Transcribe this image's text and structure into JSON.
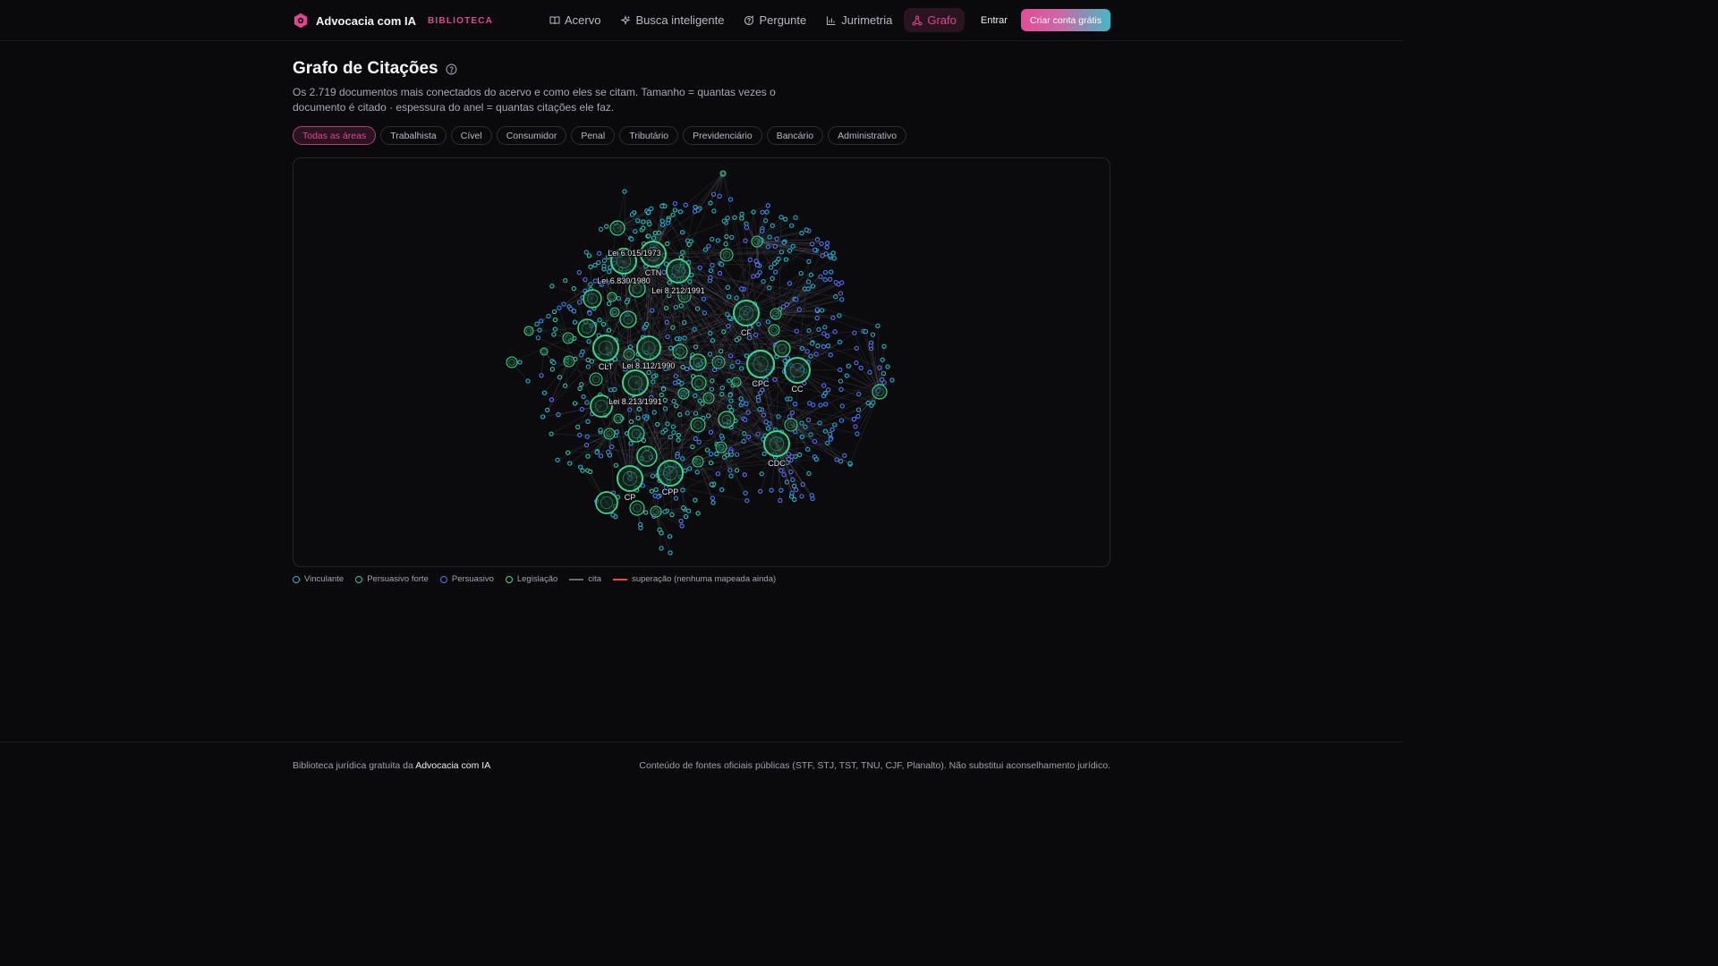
{
  "brand": {
    "name": "Advocacia com IA",
    "tag": "BIBLIOTECA"
  },
  "nav": [
    {
      "label": "Acervo",
      "icon": "book-open-icon"
    },
    {
      "label": "Busca inteligente",
      "icon": "sparkles-icon"
    },
    {
      "label": "Pergunte",
      "icon": "message-circle-question-icon"
    },
    {
      "label": "Jurimetria",
      "icon": "bar-chart-icon"
    },
    {
      "label": "Grafo",
      "icon": "graph-network-icon",
      "active": true
    }
  ],
  "auth": {
    "login_label": "Entrar",
    "signup_label": "Criar conta grátis"
  },
  "page": {
    "title": "Grafo de Citações",
    "description": "Os 2.719 documentos mais conectados do acervo e como eles se citam. Tamanho = quantas vezes o documento é citado · espessura do anel = quantas citações ele faz."
  },
  "filters": {
    "selected": "Todas as áreas",
    "options": [
      "Todas as áreas",
      "Trabalhista",
      "Cível",
      "Consumidor",
      "Penal",
      "Tributário",
      "Previdenciário",
      "Bancário",
      "Administrativo"
    ]
  },
  "graph": {
    "labeled_nodes": [
      "CTN",
      "Lei 6.830/1980",
      "Lei 8.212/1991",
      "Lei 6.015/1973",
      "CF",
      "CLT",
      "Lei 8.112/1990",
      "Lei 8.213/1991",
      "CPC",
      "CC",
      "CDC",
      "CP",
      "CPP"
    ]
  },
  "legend": [
    {
      "label": "Vinculante",
      "kind": "dot",
      "color": "#19b6c9"
    },
    {
      "label": "Persuasivo forte",
      "kind": "dot",
      "color": "#29c3a9"
    },
    {
      "label": "Persuasivo",
      "kind": "dot",
      "color": "#5b74f2"
    },
    {
      "label": "Legislação",
      "kind": "dot",
      "color": "#3fd28a"
    },
    {
      "label": "cita",
      "kind": "line",
      "color": "#6d6d76"
    },
    {
      "label": "superação (nenhuma mapeada ainda)",
      "kind": "line",
      "color": "#e5484d"
    }
  ],
  "footer": {
    "left_prefix": "Biblioteca jurídica gratuita da",
    "left_link": "Advocacia com IA",
    "right": "Conteúdo de fontes oficiais públicas (STF, STJ, TST, TNU, CJF, Planalto). Não substitui aconselhamento jurídico."
  }
}
